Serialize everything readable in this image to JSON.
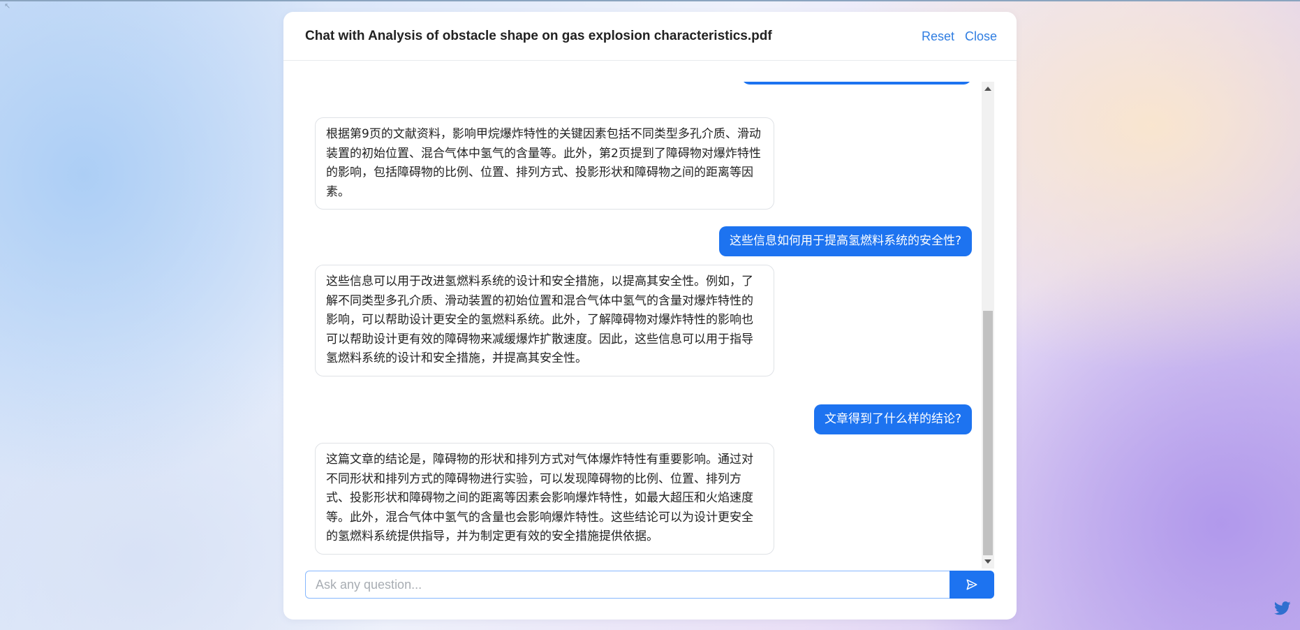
{
  "modal": {
    "title": "Chat with Analysis of obstacle shape on gas explosion characteristics.pdf",
    "reset_label": "Reset",
    "close_label": "Close"
  },
  "messages": [
    {
      "role": "assistant",
      "text": "根据第9页的文献资料，影响甲烷爆炸特性的关键因素包括不同类型多孔介质、滑动装置的初始位置、混合气体中氢气的含量等。此外，第2页提到了障碍物对爆炸特性的影响，包括障碍物的比例、位置、排列方式、投影形状和障碍物之间的距离等因素。"
    },
    {
      "role": "user",
      "text": "这些信息如何用于提高氢燃料系统的安全性?"
    },
    {
      "role": "assistant",
      "text": "这些信息可以用于改进氢燃料系统的设计和安全措施，以提高其安全性。例如，了解不同类型多孔介质、滑动装置的初始位置和混合气体中氢气的含量对爆炸特性的影响，可以帮助设计更安全的氢燃料系统。此外，了解障碍物对爆炸特性的影响也可以帮助设计更有效的障碍物来减缓爆炸扩散速度。因此，这些信息可以用于指导氢燃料系统的设计和安全措施，并提高其安全性。"
    },
    {
      "role": "user",
      "text": "文章得到了什么样的结论?"
    },
    {
      "role": "assistant",
      "text": "这篇文章的结论是，障碍物的形状和排列方式对气体爆炸特性有重要影响。通过对不同形状和排列方式的障碍物进行实验，可以发现障碍物的比例、位置、排列方式、投影形状和障碍物之间的距离等因素会影响爆炸特性，如最大超压和火焰速度等。此外，混合气体中氢气的含量也会影响爆炸特性。这些结论可以为设计更安全的氢燃料系统提供指导，并为制定更有效的安全措施提供依据。"
    }
  ],
  "input": {
    "placeholder": "Ask any question...",
    "value": ""
  },
  "icons": {
    "send": "send-icon",
    "twitter": "twitter-icon"
  },
  "colors": {
    "accent": "#1d73f0",
    "link": "#2f7de1"
  }
}
